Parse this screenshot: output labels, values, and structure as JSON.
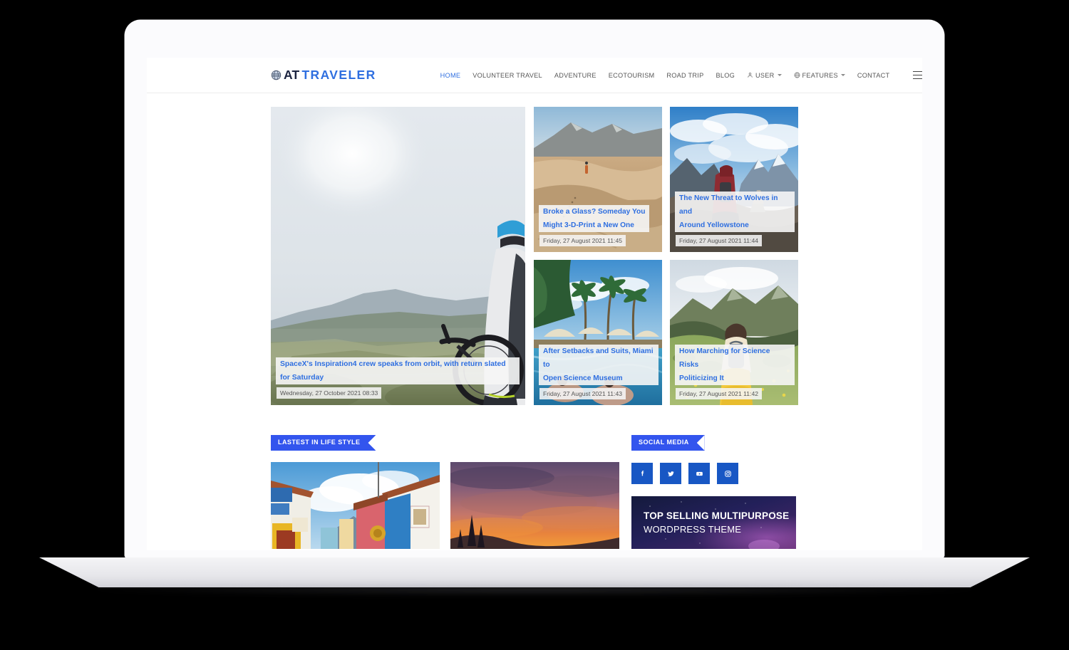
{
  "site": {
    "logo": {
      "icon": "globe-icon",
      "text_primary": "AT",
      "text_secondary": "TRAVELER"
    },
    "nav": [
      {
        "label": "HOME",
        "active": true,
        "caret": false,
        "icon": null
      },
      {
        "label": "VOLUNTEER TRAVEL",
        "active": false,
        "caret": false,
        "icon": null
      },
      {
        "label": "ADVENTURE",
        "active": false,
        "caret": false,
        "icon": null
      },
      {
        "label": "ECOTOURISM",
        "active": false,
        "caret": false,
        "icon": null
      },
      {
        "label": "ROAD TRIP",
        "active": false,
        "caret": false,
        "icon": null
      },
      {
        "label": "BLOG",
        "active": false,
        "caret": false,
        "icon": null
      },
      {
        "label": "USER",
        "active": false,
        "caret": true,
        "icon": "user-icon"
      },
      {
        "label": "FEATURES",
        "active": false,
        "caret": true,
        "icon": "globe-small-icon"
      },
      {
        "label": "CONTACT",
        "active": false,
        "caret": false,
        "icon": null
      }
    ],
    "menu_toggle": "hamburger-menu"
  },
  "hero": {
    "featured": {
      "title": "SpaceX's Inspiration4 crew speaks from orbit, with return slated for Saturday",
      "date": "Wednesday, 27 October 2021 08:33",
      "image": "mountain-biker-overlooking-valley"
    },
    "cards": [
      {
        "title_line1": "Broke a Glass? Someday You",
        "title_line2": "Might 3-D-Print a New One",
        "date": "Friday, 27 August 2021 11:45",
        "image": "sand-dunes-hiker"
      },
      {
        "title_line1": "The New Threat to Wolves in and",
        "title_line2": "Around Yellowstone",
        "date": "Friday, 27 August 2021 11:44",
        "image": "hiker-mountain-summit-clouds"
      },
      {
        "title_line1": "After Setbacks and Suits, Miami to",
        "title_line2": "Open Science Museum",
        "date": "Friday, 27 August 2021 11:43",
        "image": "tropical-pool-palm-trees"
      },
      {
        "title_line1": "How Marching for Science Risks",
        "title_line2": "Politicizing It",
        "date": "Friday, 27 August 2021 11:42",
        "image": "woman-walking-green-valley"
      }
    ]
  },
  "lifestyle": {
    "heading": "LASTEST IN LIFE STYLE",
    "items": [
      {
        "image": "colorful-colonial-street"
      },
      {
        "image": "orange-sunset-sky"
      }
    ]
  },
  "social": {
    "heading": "SOCIAL MEDIA",
    "links": [
      {
        "name": "facebook-icon",
        "label": "Facebook"
      },
      {
        "name": "twitter-icon",
        "label": "Twitter"
      },
      {
        "name": "youtube-icon",
        "label": "YouTube"
      },
      {
        "name": "instagram-icon",
        "label": "Instagram"
      }
    ]
  },
  "promo": {
    "line1": "TOP SELLING MULTIPURPOSE",
    "line2": "WORDPRESS THEME"
  },
  "colors": {
    "accent_blue": "#2f6fe0",
    "ribbon_blue": "#3355ee",
    "social_blue": "#1857c4",
    "nav_text": "#585858"
  }
}
